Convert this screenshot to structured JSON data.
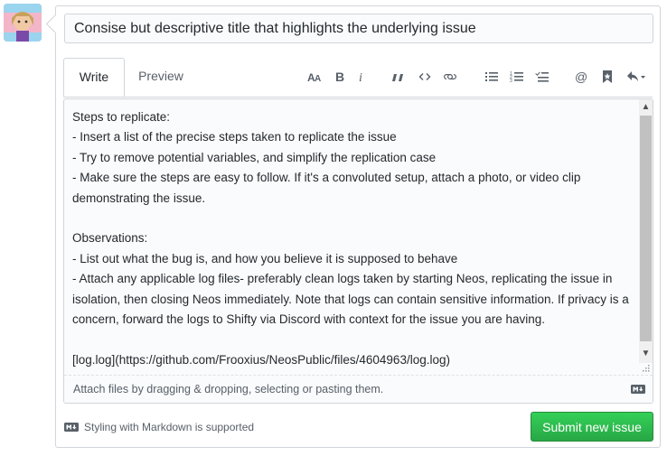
{
  "title_input": {
    "value": "Consise but descriptive title that highlights the underlying issue"
  },
  "tabs": [
    {
      "label": "Write",
      "active": true
    },
    {
      "label": "Preview",
      "active": false
    }
  ],
  "toolbar": {
    "icons": [
      "text-size-icon",
      "bold-icon",
      "italic-icon",
      "quote-icon",
      "code-icon",
      "link-icon",
      "bulleted-list-icon",
      "numbered-list-icon",
      "task-list-icon",
      "mention-icon",
      "reference-icon",
      "reply-icon"
    ]
  },
  "editor": {
    "body": "Steps to replicate:\n- Insert a list of the precise steps taken to replicate the issue\n- Try to remove potential variables, and simplify the replication case\n- Make sure the steps are easy to follow. If it's a convoluted setup, attach a photo, or video clip demonstrating the issue.\n\nObservations:\n- List out what the bug is, and how you believe it is supposed to behave\n- Attach any applicable log files- preferably clean logs taken by starting Neos, replicating the issue in isolation, then closing Neos immediately. Note that logs can contain sensitive information. If privacy is a concern, forward the logs to Shifty via Discord with context for the issue you are having.\n\n[log.log](https://github.com/Frooxius/NeosPublic/files/4604963/log.log)",
    "dropzone_text": "Attach files by dragging & dropping, selecting or pasting them."
  },
  "footer": {
    "markdown_note": "Styling with Markdown is supported",
    "submit_label": "Submit new issue"
  },
  "colors": {
    "submit_green": "#28a745",
    "border": "#d1d5da",
    "muted_text": "#586069"
  }
}
